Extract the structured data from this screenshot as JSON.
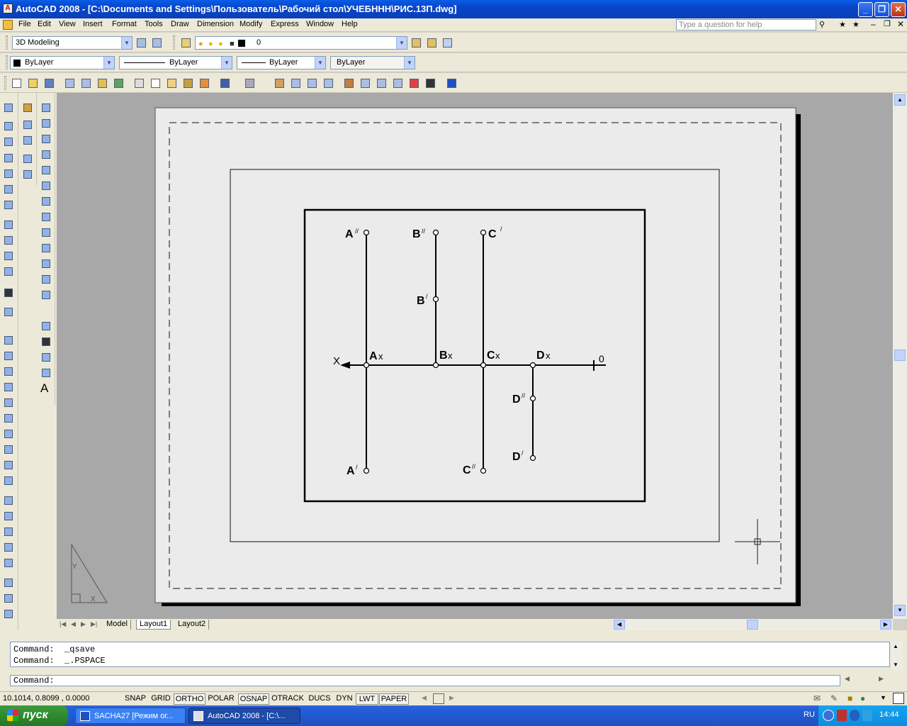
{
  "window": {
    "title": "AutoCAD 2008 - [C:\\Documents and Settings\\Пользователь\\Рабочий стол\\УЧЕБННН\\РИС.13П.dwg]",
    "controls": [
      "_",
      "❐",
      "✕"
    ]
  },
  "menu": {
    "items": [
      "File",
      "Edit",
      "View",
      "Insert",
      "Format",
      "Tools",
      "Draw",
      "Dimension",
      "Modify",
      "Express",
      "Window",
      "Help"
    ],
    "help_placeholder": "Type a question for help"
  },
  "toolbar": {
    "workspace": "3D Modeling",
    "layer": "0",
    "color": "ByLayer",
    "linetype": "ByLayer",
    "lineweight": "ByLayer",
    "plotstyle": "ByLayer"
  },
  "drawing": {
    "labels": {
      "a_dd": "A",
      "b_dd": "B",
      "c_d": "C",
      "b_d": "B",
      "x_axis": "X",
      "zero": "0",
      "ax": "A",
      "bx": "B",
      "cx": "C",
      "dx": "D",
      "x_sub": "x",
      "d_dd": "D",
      "d_d": "D",
      "a_d": "A",
      "c_dd": "C",
      "dprime": "//",
      "sprime": "/"
    }
  },
  "tabs": [
    "Model",
    "Layout1",
    "Layout2"
  ],
  "command": {
    "history": [
      "Command:  _qsave",
      "Command:  _.PSPACE"
    ],
    "prompt": "Command:"
  },
  "status": {
    "coords": "10.1014, 0.8099 , 0.0000",
    "buttons": [
      "SNAP",
      "GRID",
      "ORTHO",
      "POLAR",
      "OSNAP",
      "OTRACK",
      "DUCS",
      "DYN",
      "LWT",
      "PAPER"
    ]
  },
  "taskbar": {
    "start": "пуск",
    "tasks": [
      "SACHA27 [Режим ог...",
      "AutoCAD 2008 - [C:\\..."
    ],
    "lang": "RU",
    "clock": "14:44"
  },
  "colors": {
    "titlebar": "#0a5ce8",
    "canvas": "#a8a8a8",
    "paper": "#ebebeb",
    "taskbar": "#245edb",
    "start": "#2f8a2f"
  }
}
